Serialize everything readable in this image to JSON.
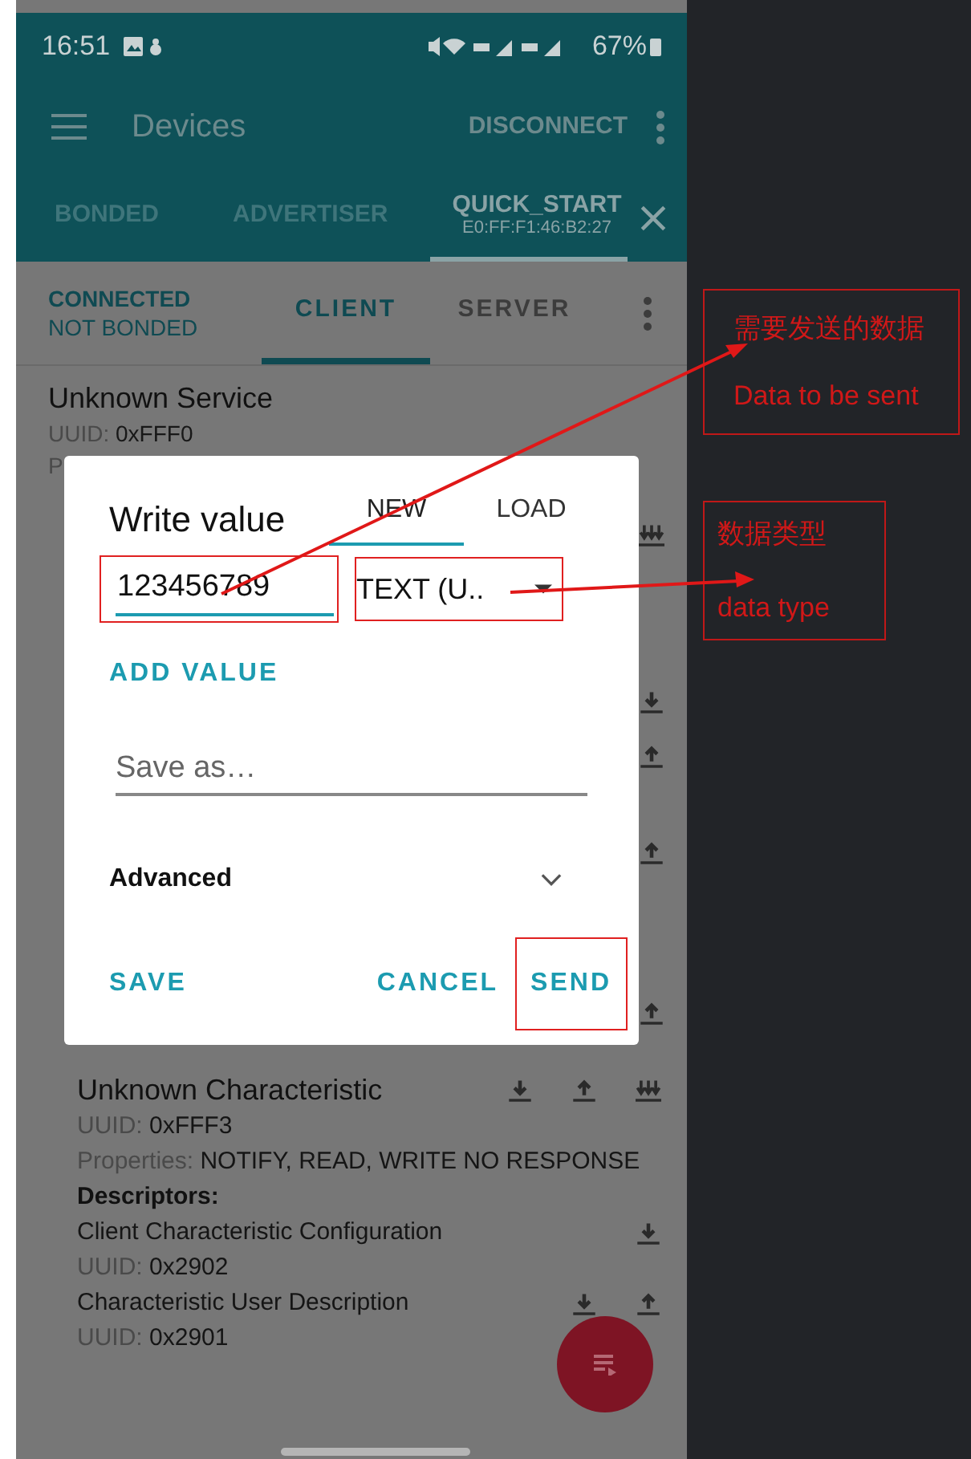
{
  "status_bar": {
    "time": "16:51",
    "battery": "67%"
  },
  "app_bar": {
    "title": "Devices",
    "action": "DISCONNECT"
  },
  "device_tabs": [
    {
      "label": "BONDED",
      "selected": false
    },
    {
      "label": "ADVERTISER",
      "selected": false
    },
    {
      "label": "QUICK_START",
      "sublabel": "E0:FF:F1:46:B2:27",
      "selected": true
    }
  ],
  "connection": {
    "state": "CONNECTED",
    "bond": "NOT BONDED"
  },
  "mode_tabs": [
    {
      "label": "CLIENT",
      "selected": true
    },
    {
      "label": "SERVER",
      "selected": false
    }
  ],
  "service": {
    "name": "Unknown Service",
    "uuid_label": "UUID:",
    "uuid": "0xFFF0",
    "properties_partial": "P"
  },
  "characteristic": {
    "name": "Unknown Characteristic",
    "uuid_label": "UUID:",
    "uuid": "0xFFF3",
    "properties_label": "Properties:",
    "properties": "NOTIFY, READ, WRITE NO RESPONSE",
    "descriptors_label": "Descriptors:",
    "descriptors": [
      {
        "name": "Client Characteristic Configuration",
        "uuid_label": "UUID:",
        "uuid": "0x2902"
      },
      {
        "name": "Characteristic User Description",
        "uuid_label": "UUID:",
        "uuid": "0x2901"
      }
    ]
  },
  "dialog": {
    "title": "Write value",
    "tabs": [
      {
        "label": "NEW",
        "selected": true
      },
      {
        "label": "LOAD",
        "selected": false
      }
    ],
    "value": "123456789",
    "type": "TEXT (U..",
    "add_value": "ADD VALUE",
    "save_as_placeholder": "Save as…",
    "advanced": "Advanced",
    "advanced_expanded": false,
    "buttons": [
      "SAVE",
      "CANCEL",
      "SEND"
    ]
  },
  "annotations": [
    {
      "lines": [
        "需要发送的数据",
        "Data to be sent"
      ]
    },
    {
      "lines": [
        "数据类型",
        "data type"
      ]
    }
  ]
}
